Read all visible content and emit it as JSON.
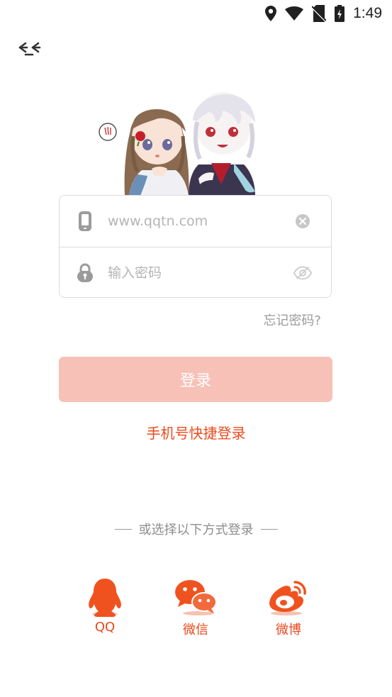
{
  "status_bar": {
    "time": "1:49"
  },
  "phone_field": {
    "placeholder": "www.qqtn.com",
    "value": ""
  },
  "password_field": {
    "placeholder": "输入密码",
    "value": ""
  },
  "forgot_password": "忘记密码?",
  "login_button": "登录",
  "quick_login": "手机号快捷登录",
  "divider_text": "或选择以下方式登录",
  "social": [
    {
      "label": "QQ",
      "icon": "qq-icon"
    },
    {
      "label": "微信",
      "icon": "wechat-icon"
    },
    {
      "label": "微博",
      "icon": "weibo-icon"
    }
  ],
  "colors": {
    "accent": "#ec4a1d",
    "login_button_bg": "#f7c1b7",
    "border": "#dcdcdc",
    "placeholder": "#b5b5b5"
  }
}
